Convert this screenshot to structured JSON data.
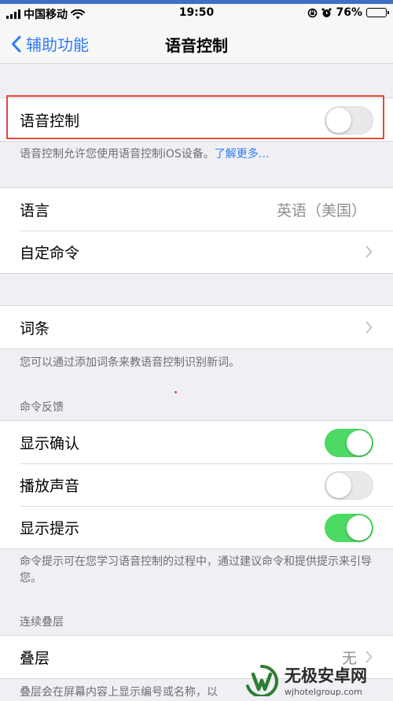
{
  "status_bar": {
    "carrier": "中国移动",
    "time": "19:50",
    "battery_percent": "76%",
    "battery_level": 0.76
  },
  "nav": {
    "back_label": "辅助功能",
    "title": "语音控制"
  },
  "voice_control": {
    "label": "语音控制",
    "enabled": false,
    "footnote": "语音控制允许您使用语音控制iOS设备。",
    "learn_more": "了解更多…"
  },
  "language_group": {
    "language_label": "语言",
    "language_value": "英语（美国）",
    "custom_commands_label": "自定命令"
  },
  "vocabulary": {
    "label": "词条",
    "footnote": "您可以通过添加词条来教语音控制识别新词。"
  },
  "command_feedback": {
    "header": "命令反馈",
    "show_confirmation": {
      "label": "显示确认",
      "enabled": true
    },
    "play_sound": {
      "label": "播放声音",
      "enabled": false
    },
    "show_hints": {
      "label": "显示提示",
      "enabled": true
    },
    "footnote": "命令提示可在您学习语音控制的过程中，通过建议命令和提供提示来引导您。"
  },
  "continuous_overlay": {
    "header": "连续叠层",
    "overlay_label": "叠层",
    "overlay_value": "无",
    "footnote": "叠层会在屏幕内容上显示编号或名称，以"
  },
  "watermark": {
    "title": "无极安卓网",
    "url": "wjhotelgroup.com"
  },
  "colors": {
    "accent": "#2f7cf6",
    "toggle_on": "#4cd964",
    "highlight": "#e8473b",
    "background": "#efeff4"
  }
}
